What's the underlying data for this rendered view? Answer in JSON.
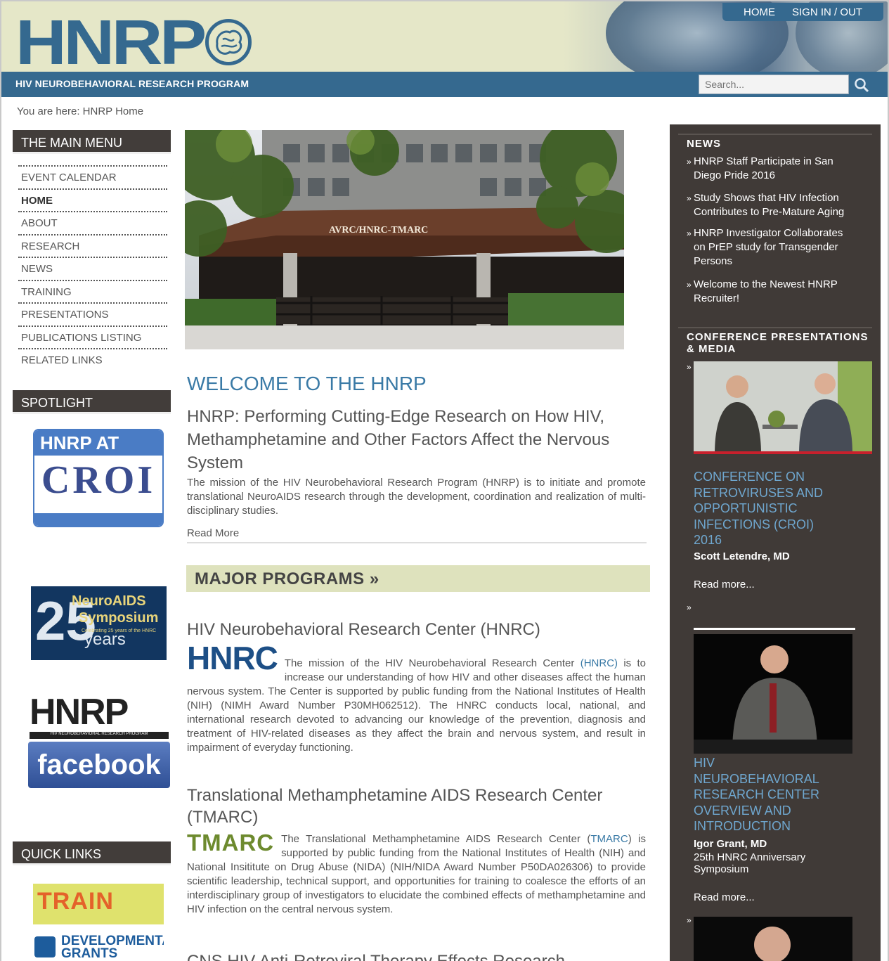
{
  "header": {
    "logo_text": "HNRP",
    "tagline": "HIV NEUROBEHAVIORAL RESEARCH PROGRAM",
    "nav": [
      "HOME",
      "SIGN IN / OUT"
    ],
    "search_placeholder": "Search..."
  },
  "breadcrumb": "You are here: HNRP Home",
  "left": {
    "main_menu_title": "THE MAIN MENU",
    "menu_items": [
      "EVENT CALENDAR",
      "HOME",
      "ABOUT",
      "RESEARCH",
      "NEWS",
      "TRAINING",
      "PRESENTATIONS",
      "PUBLICATIONS LISTING",
      "RELATED LINKS"
    ],
    "active_item": "HOME",
    "spotlight_title": "SPOTLIGHT",
    "spot_croi": {
      "line1": "HNRP AT",
      "line2": "CROI"
    },
    "spot_neuro": {
      "big": "25",
      "line1": "NeuroAIDS",
      "line2": "Symposium",
      "line3": "Celebrating 25 years of the HNRC",
      "line4": "years"
    },
    "spot_fb": {
      "line1": "HNRP",
      "line2": "HIV NEUROBEHAVIORAL RESEARCH PROGRAM",
      "line3": "facebook"
    },
    "quick_links_title": "QUICK LINKS",
    "ql_train": "TRAIN",
    "ql_devgrants": "DEVELOPMENTAL GRANTS"
  },
  "main": {
    "hero_sign": "AVRC/HNRC-TMARC",
    "welcome": "WELCOME TO THE HNRP",
    "subhead": "HNRP: Performing Cutting-Edge Research on How HIV, Methamphetamine and Other Factors Affect the Nervous System",
    "mission": "The mission of the HIV Neurobehavioral Research Program (HNRP) is to initiate and promote translational NeuroAIDS research through the development, coordination and realization of multi-disciplinary studies.",
    "read_more": "Read More",
    "major_programs": "MAJOR PROGRAMS »",
    "hnrc_title": "HIV Neurobehavioral Research Center (HNRC)",
    "hnrc_logo": "HNRC",
    "hnrc_text_a": "The mission of the HIV Neurobehavioral Research Center ",
    "hnrc_link": "(HNRC)",
    "hnrc_text_b": " is to increase our understanding of how HIV and other diseases affect the human nervous system. The Center is supported by public funding from the National Institutes of Health (NIH) (NIMH Award Number P30MH062512). The HNRC conducts local, national, and international research devoted to advancing our knowledge of the prevention, diagnosis and treatment of HIV-related diseases as they affect the brain and nervous system, and result in impairment of everyday functioning.",
    "tmarc_title": "Translational Methamphetamine AIDS Research Center (TMARC)",
    "tmarc_logo": "TMARC",
    "tmarc_text_a": "The Translational Methamphetamine AIDS Research Center (",
    "tmarc_link": "TMARC",
    "tmarc_text_b": ") is supported by public funding from the National Institutes of Health (NIH) and National Insititute on Drug Abuse (NIDA) (NIH/NIDA Award Number P50DA026306) to provide scientific leadership, technical support, and opportunities for training to coalesce the efforts of an interdisciplinary group of investigators to elucidate the combined effects of methamphetamine and HIV infection on the central nervous system.",
    "cns_title": "CNS HIV Anti-Retroviral Therapy Effects Research"
  },
  "right": {
    "news_title": "NEWS",
    "news": [
      "HNRP Staff Participate in San Diego Pride 2016",
      "Study Shows that HIV Infection Contributes to Pre-Mature Aging",
      "HNRP Investigator Collaborates on PrEP study for Transgender Persons",
      "Welcome to the Newest HNRP Recruiter!"
    ],
    "conf_title": "CONFERENCE PRESENTATIONS & MEDIA",
    "items": [
      {
        "title": "CONFERENCE ON RETROVIRUSES AND OPPORTUNISTIC INFECTIONS (CROI) 2016",
        "speaker": "Scott Letendre, MD",
        "note": "",
        "more": "Read more..."
      },
      {
        "title": "HIV NEUROBEHAVIORAL RESEARCH CENTER OVERVIEW AND INTRODUCTION",
        "speaker": "Igor Grant, MD",
        "note": "25th HNRC Anniversary Symposium",
        "more": "Read more..."
      }
    ],
    "arrow": "»"
  }
}
